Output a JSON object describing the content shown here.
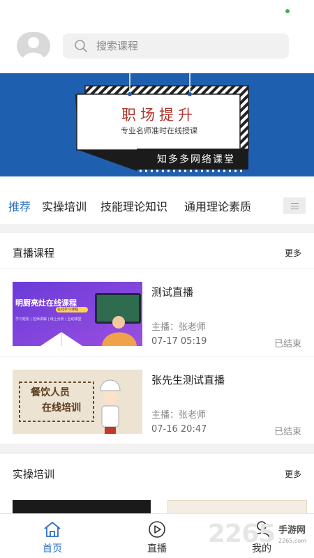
{
  "search": {
    "placeholder": "搜索课程"
  },
  "banner": {
    "title": "职场提升",
    "subtitle": "专业名师准时在线授课",
    "brand": "知多多网络课堂"
  },
  "tabs": [
    {
      "label": "推荐",
      "active": true
    },
    {
      "label": "实操培训"
    },
    {
      "label": "技能理论知识"
    },
    {
      "label": "通用理论素质"
    }
  ],
  "live_section": {
    "title": "直播课程",
    "more": "更多",
    "courses": [
      {
        "title": "测试直播",
        "host": "主播：张老师",
        "time": "07-17 05:19",
        "status": "已结束",
        "thumb": {
          "headline": "明厨亮灶在线课程",
          "tag": "在线学习课程",
          "caption": "学习轻松 | 名师讲解 | 线上分析 | 互动课堂"
        }
      },
      {
        "title": "张先生测试直播",
        "host": "主播：张老师",
        "time": "07-16 20:47",
        "status": "已结束",
        "thumb": {
          "line1": "餐饮人员",
          "line2": "在线培训"
        }
      }
    ]
  },
  "practice_section": {
    "title": "实操培训",
    "more": "更多"
  },
  "bottom_nav": [
    {
      "label": "首页",
      "icon": "home-icon",
      "active": true
    },
    {
      "label": "直播",
      "icon": "play-circle-icon"
    },
    {
      "label": "我的",
      "icon": "user-icon"
    }
  ],
  "watermark": {
    "number": "2265",
    "text": "手游网",
    "url": "2265.com"
  },
  "colors": {
    "accent": "#2a6fc6",
    "banner": "#1f5fb0",
    "status_dot": "#3cb34a"
  }
}
